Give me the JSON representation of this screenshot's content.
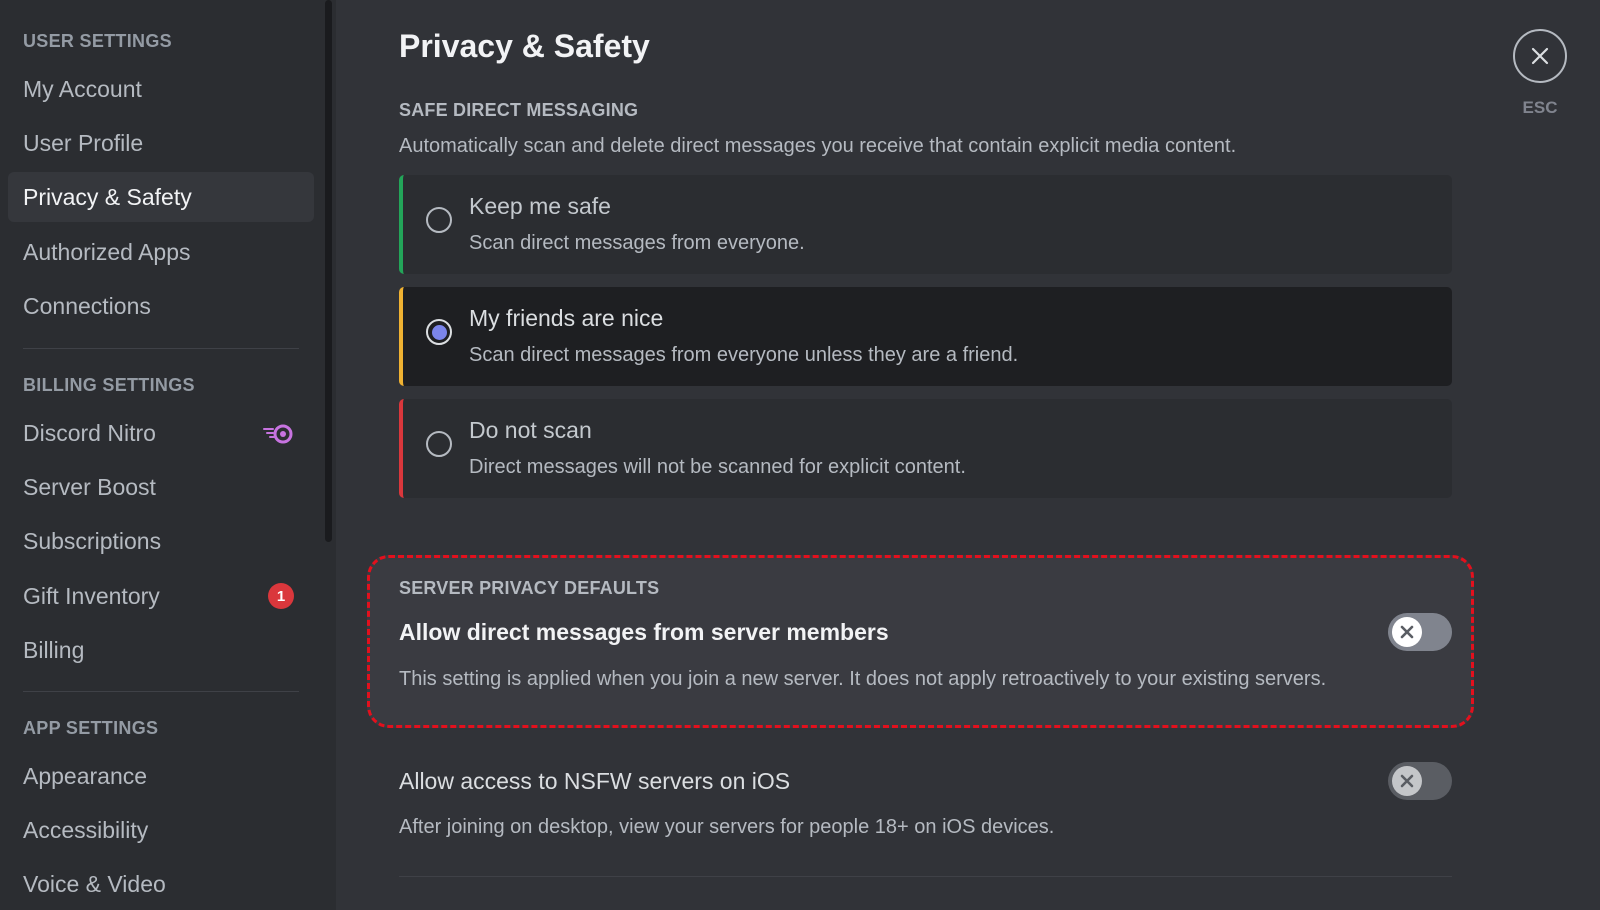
{
  "sidebar": {
    "user_settings_header": "User Settings",
    "user_items": [
      {
        "label": "My Account"
      },
      {
        "label": "User Profile"
      },
      {
        "label": "Privacy & Safety",
        "active": true
      },
      {
        "label": "Authorized Apps"
      },
      {
        "label": "Connections"
      }
    ],
    "billing_settings_header": "Billing Settings",
    "billing_items": [
      {
        "label": "Discord Nitro",
        "icon": "nitro-icon"
      },
      {
        "label": "Server Boost"
      },
      {
        "label": "Subscriptions"
      },
      {
        "label": "Gift Inventory",
        "badge": "1"
      },
      {
        "label": "Billing"
      }
    ],
    "app_settings_header": "App Settings",
    "app_items": [
      {
        "label": "Appearance"
      },
      {
        "label": "Accessibility"
      },
      {
        "label": "Voice & Video"
      }
    ]
  },
  "main": {
    "title": "Privacy & Safety",
    "safe_dm": {
      "header": "Safe Direct Messaging",
      "description": "Automatically scan and delete direct messages you receive that contain explicit media content.",
      "options": [
        {
          "title": "Keep me safe",
          "description": "Scan direct messages from everyone.",
          "accent": "#23a559",
          "selected": false
        },
        {
          "title": "My friends are nice",
          "description": "Scan direct messages from everyone unless they are a friend.",
          "accent": "#f0b232",
          "selected": true
        },
        {
          "title": "Do not scan",
          "description": "Direct messages will not be scanned for explicit content.",
          "accent": "#da373c",
          "selected": false
        }
      ]
    },
    "server_privacy": {
      "header": "Server Privacy Defaults",
      "allow_dm_title": "Allow direct messages from server members",
      "allow_dm_description": "This setting is applied when you join a new server. It does not apply retroactively to your existing servers.",
      "allow_dm_enabled": false
    },
    "nsfw_ios": {
      "title": "Allow access to NSFW servers on iOS",
      "description": "After joining on desktop, view your servers for people 18+ on iOS devices.",
      "enabled": false
    }
  },
  "close": {
    "label": "ESC",
    "icon": "close-icon"
  },
  "colors": {
    "highlight_border": "#e3101d",
    "radio_selected": "#7b85ea",
    "badge": "#da373c"
  }
}
